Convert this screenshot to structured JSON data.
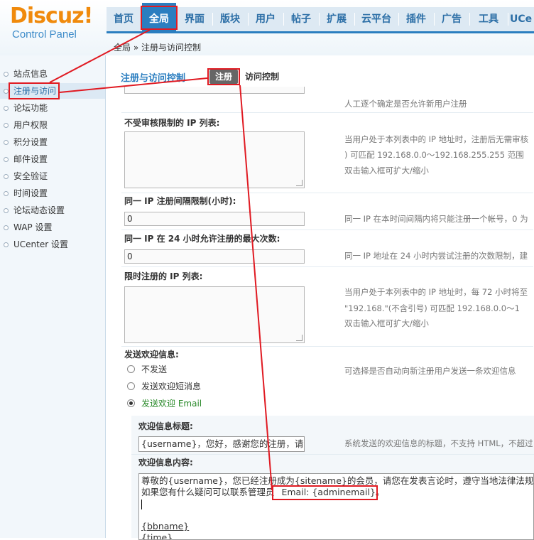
{
  "logo": {
    "main": "Discuz!",
    "sub": "Control Panel"
  },
  "nav": [
    "首页",
    "全局",
    "界面",
    "版块",
    "用户",
    "帖子",
    "扩展",
    "云平台",
    "插件",
    "广告",
    "工具",
    "UCe"
  ],
  "nav_active_index": 1,
  "breadcrumb": "全局 » 注册与访问控制",
  "sidebar": [
    "站点信息",
    "注册与访问",
    "论坛功能",
    "用户权限",
    "积分设置",
    "邮件设置",
    "安全验证",
    "时间设置",
    "论坛动态设置",
    "WAP 设置",
    "UCenter 设置"
  ],
  "sidebar_active_index": 1,
  "section": {
    "title": "注册与访问控制",
    "tab_active": "注册",
    "tab_other": "访问控制"
  },
  "rows": {
    "top_hint": "人工逐个确定是否允许新用户注册",
    "ip_exempt": {
      "label": "不受审核限制的 IP 列表:",
      "hint1": "当用户处于本列表中的 IP 地址时，注册后无需审核",
      "hint2": ") 可匹配 192.168.0.0～192.168.255.255 范围",
      "hint3": "双击输入框可扩大/缩小"
    },
    "ip_interval": {
      "label": "同一 IP 注册间隔限制(小时):",
      "value": "0",
      "hint": "同一 IP 在本时间间隔内将只能注册一个帐号，0 为"
    },
    "ip_max24": {
      "label": "同一 IP 在 24 小时允许注册的最大次数:",
      "value": "0",
      "hint": "同一 IP 地址在 24 小时内尝试注册的次数限制，建"
    },
    "ip_limit": {
      "label": "限时注册的 IP 列表:",
      "hint1": "当用户处于本列表中的 IP 地址时，每 72 小时将至",
      "hint2": "\"192.168.\"(不含引号) 可匹配 192.168.0.0～1",
      "hint3": "双击输入框可扩大/缩小"
    },
    "welcome": {
      "label": "发送欢迎信息:",
      "options": [
        "不发送",
        "发送欢迎短消息",
        "发送欢迎 Email"
      ],
      "selected_index": 2,
      "hint": "可选择是否自动向新注册用户发送一条欢迎信息"
    },
    "welcome_title": {
      "label": "欢迎信息标题:",
      "value": "{username}，您好，感谢您的注册，请阅",
      "hint": "系统发送的欢迎信息的标题，不支持 HTML，不超过"
    },
    "welcome_content": {
      "label": "欢迎信息内容:",
      "line1": "尊敬的{username}，您已经注册成为{sitename}的会员，请您在发表言论时，遵守当地法律法规。",
      "line2": "如果您有什么疑问可以联系管理员 ",
      "line2_email": "Email: {adminemail}",
      "line2_end": "。",
      "line3": "{bbname}",
      "line4": "{time}"
    }
  },
  "colors": {
    "accent": "#2b7ec0",
    "annotation": "#e01a22",
    "logo_orange": "#f08a0c"
  }
}
